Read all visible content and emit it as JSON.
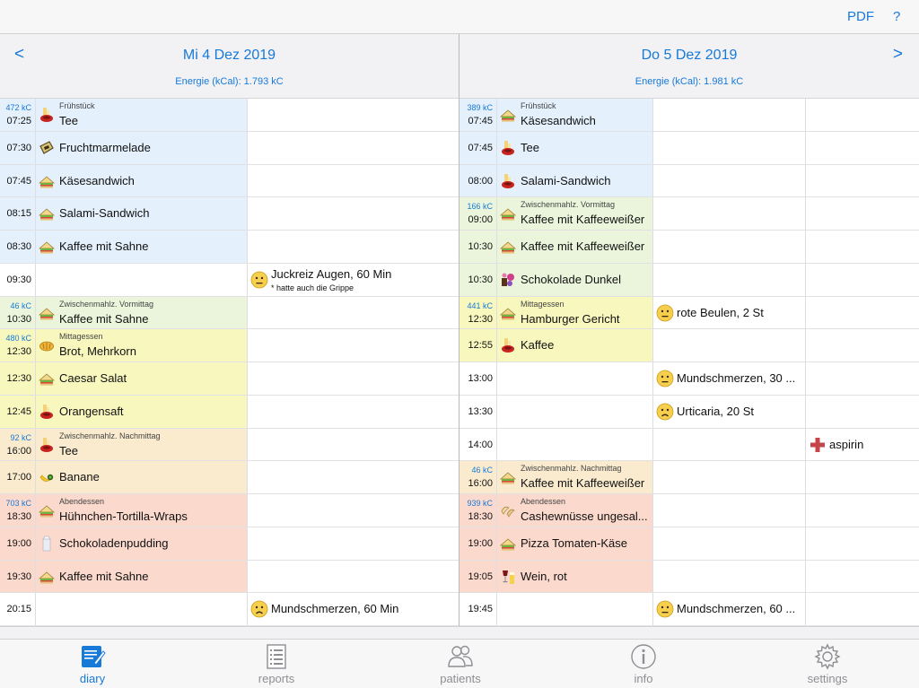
{
  "colors": {
    "accent": "#1779d8",
    "breakfast": "#e4f0fb",
    "snack_morning": "#ebf5dc",
    "lunch": "#f8f8be",
    "snack_afternoon": "#faebcf",
    "dinner": "#fbd9cd",
    "empty": "#ffffff"
  },
  "toolbar": {
    "pdf_label": "PDF",
    "help_label": "?"
  },
  "days": [
    {
      "prev_label": "<",
      "title": "Mi 4 Dez 2019",
      "energy": "Energie (kCal): 1.793 kC",
      "rows": [
        {
          "meal": "breakfast",
          "kc": "472 kC",
          "time": "07:25",
          "category": "Frühstück",
          "item": "Tee",
          "icon": "tea-icon"
        },
        {
          "meal": "breakfast",
          "time": "07:30",
          "item": "Fruchtmarmelade",
          "icon": "jam-icon"
        },
        {
          "meal": "breakfast",
          "time": "07:45",
          "item": "Käsesandwich",
          "icon": "sandwich-icon"
        },
        {
          "meal": "breakfast",
          "time": "08:15",
          "item": "Salami-Sandwich",
          "icon": "sandwich-icon"
        },
        {
          "meal": "breakfast",
          "time": "08:30",
          "item": "Kaffee mit Sahne",
          "icon": "sandwich-icon"
        },
        {
          "meal": "empty",
          "time": "09:30",
          "symptom": "Juckreiz Augen, 60 Min",
          "symptom_note": "* hatte auch die Grippe",
          "symptom_icon": "neutral-face-icon"
        },
        {
          "meal": "snack_morning",
          "kc": "46 kC",
          "time": "10:30",
          "category": "Zwischenmahlz. Vormittag",
          "item": "Kaffee mit Sahne",
          "icon": "sandwich-icon"
        },
        {
          "meal": "lunch",
          "kc": "480 kC",
          "time": "12:30",
          "category": "Mittagessen",
          "item": "Brot, Mehrkorn",
          "icon": "bread-icon"
        },
        {
          "meal": "lunch",
          "time": "12:30",
          "item": "Caesar Salat",
          "icon": "sandwich-icon"
        },
        {
          "meal": "lunch",
          "time": "12:45",
          "item": "Orangensaft",
          "icon": "tea-icon"
        },
        {
          "meal": "snack_afternoon",
          "kc": "92 kC",
          "time": "16:00",
          "category": "Zwischenmahlz. Nachmittag",
          "item": "Tee",
          "icon": "tea-icon"
        },
        {
          "meal": "snack_afternoon",
          "time": "17:00",
          "item": "Banane",
          "icon": "fruit-icon"
        },
        {
          "meal": "dinner",
          "kc": "703 kC",
          "time": "18:30",
          "category": "Abendessen",
          "item": "Hühnchen-Tortilla-Wraps",
          "icon": "sandwich-icon"
        },
        {
          "meal": "dinner",
          "time": "19:00",
          "item": "Schokoladenpudding",
          "icon": "milk-icon"
        },
        {
          "meal": "dinner",
          "time": "19:30",
          "item": "Kaffee mit Sahne",
          "icon": "sandwich-icon"
        },
        {
          "meal": "empty",
          "time": "20:15",
          "symptom": "Mundschmerzen, 60 Min",
          "symptom_icon": "sad-face-icon"
        }
      ]
    },
    {
      "next_label": ">",
      "title": "Do 5 Dez 2019",
      "energy": "Energie (kCal): 1.981 kC",
      "rows": [
        {
          "meal": "breakfast",
          "kc": "389 kC",
          "time": "07:45",
          "category": "Frühstück",
          "item": "Käsesandwich",
          "icon": "sandwich-icon"
        },
        {
          "meal": "breakfast",
          "time": "07:45",
          "item": "Tee",
          "icon": "tea-icon"
        },
        {
          "meal": "breakfast",
          "time": "08:00",
          "item": "Salami-Sandwich",
          "icon": "tea-icon"
        },
        {
          "meal": "snack_morning",
          "kc": "166 kC",
          "time": "09:00",
          "category": "Zwischenmahlz. Vormittag",
          "item": "Kaffee mit Kaffeeweißer",
          "icon": "sandwich-icon"
        },
        {
          "meal": "snack_morning",
          "time": "10:30",
          "item": "Kaffee mit Kaffeeweißer",
          "icon": "sandwich-icon"
        },
        {
          "meal": "snack_morning",
          "time": "10:30",
          "item": "Schokolade Dunkel",
          "icon": "sweets-icon"
        },
        {
          "meal": "lunch",
          "kc": "441 kC",
          "time": "12:30",
          "category": "Mittagessen",
          "item": "Hamburger Gericht",
          "icon": "sandwich-icon",
          "symptom": "rote Beulen, 2 St",
          "symptom_icon": "neutral-face-icon"
        },
        {
          "meal": "lunch",
          "time": "12:55",
          "item": "Kaffee",
          "icon": "tea-icon"
        },
        {
          "meal": "empty",
          "time": "13:00",
          "symptom": "Mundschmerzen, 30 ...",
          "symptom_icon": "neutral-face-icon"
        },
        {
          "meal": "empty",
          "time": "13:30",
          "symptom": "Urticaria, 20 St",
          "symptom_icon": "sad-face-icon"
        },
        {
          "meal": "empty",
          "time": "14:00",
          "medication": "aspirin",
          "medication_icon": "red-cross-icon"
        },
        {
          "meal": "snack_afternoon",
          "kc": "46 kC",
          "time": "16:00",
          "category": "Zwischenmahlz. Nachmittag",
          "item": "Kaffee mit Kaffeeweißer",
          "icon": "sandwich-icon"
        },
        {
          "meal": "dinner",
          "kc": "939 kC",
          "time": "18:30",
          "category": "Abendessen",
          "item": "Cashewnüsse ungesal...",
          "icon": "nuts-icon"
        },
        {
          "meal": "dinner",
          "time": "19:00",
          "item": "Pizza Tomaten-Käse",
          "icon": "sandwich-icon"
        },
        {
          "meal": "dinner",
          "time": "19:05",
          "item": "Wein, rot",
          "icon": "wine-icon"
        },
        {
          "meal": "empty",
          "time": "19:45",
          "symptom": "Mundschmerzen, 60 ...",
          "symptom_icon": "neutral-face-icon"
        }
      ]
    }
  ],
  "tabs": [
    {
      "label": "diary",
      "icon": "diary-icon",
      "active": true
    },
    {
      "label": "reports",
      "icon": "reports-icon",
      "active": false
    },
    {
      "label": "patients",
      "icon": "patients-icon",
      "active": false
    },
    {
      "label": "info",
      "icon": "info-icon",
      "active": false
    },
    {
      "label": "settings",
      "icon": "gear-icon",
      "active": false
    }
  ]
}
